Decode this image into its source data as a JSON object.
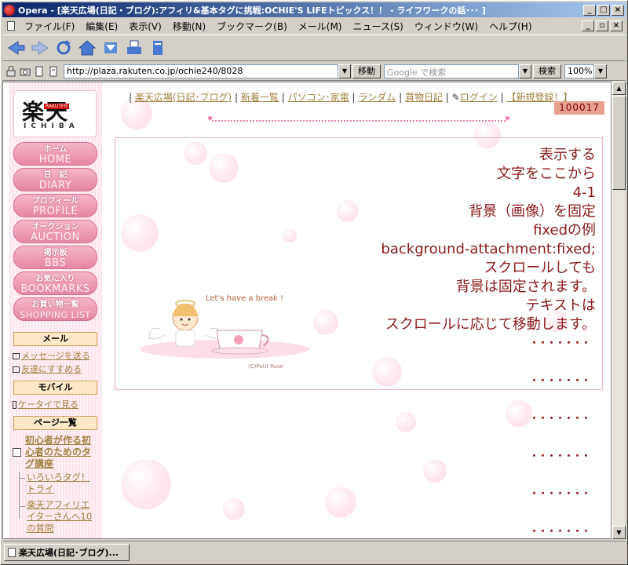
{
  "browser": {
    "title": "Opera - [楽天広場(日記・ブログ):アフィリ&基本タグに挑戦:OCHIE'S LIFEトピックス！！ - ライフワークの話･･･ ]",
    "menu": [
      "ファイル(F)",
      "編集(E)",
      "表示(V)",
      "移動(N)",
      "ブックマーク(B)",
      "メール(M)",
      "ニュース(S)",
      "ウィンドウ(W)",
      "ヘルプ(H)"
    ],
    "address": "http://plaza.rakuten.co.jp/ochie240/8028",
    "go_label": "移動",
    "search_placeholder": "Google で検索",
    "search_label": "検索",
    "zoom": "100%",
    "status_tab": "楽天広場(日記･ブログ)..."
  },
  "sidebar": {
    "logo_main": "楽天",
    "logo_tag": "RAKUTEN",
    "logo_sub": "ICHIBA",
    "nav": [
      {
        "jp": "ホーム",
        "en": "HOME"
      },
      {
        "jp": "日　記",
        "en": "DIARY"
      },
      {
        "jp": "プロフィール",
        "en": "PROFILE"
      },
      {
        "jp": "オークション",
        "en": "AUCTION"
      },
      {
        "jp": "掲示板",
        "en": "BBS"
      },
      {
        "jp": "お気に入り",
        "en": "BOOKMARKS"
      },
      {
        "jp": "お買い物一覧",
        "en": "SHOPPING LIST"
      }
    ],
    "mail_head": "メール",
    "mail_links": [
      "メッセージを送る",
      "友達にすすめる"
    ],
    "mobile_head": "モバイル",
    "mobile_link": "ケータイで見る",
    "pages_head": "ページ一覧",
    "pages_main": "初心者が作る初心者のためのタグ講座",
    "pages_sub1": "いろいろタグ！トライ",
    "pages_sub2": "楽天アフィリエイターさんへ10の質問"
  },
  "topnav": {
    "links": [
      "楽天広場(日記･ブログ)",
      "新着一覧",
      "パソコン･家電",
      "ランダム",
      "買物日記",
      "ログイン",
      "【新規登録！】"
    ],
    "counter": "100017"
  },
  "content": {
    "lines": [
      "表示する",
      "文字をここから",
      "4-1",
      "背景（画像）を固定",
      "fixedの例",
      "background-attachment:fixed;",
      "スクロールしても",
      "背景は固定されます。",
      "テキストは",
      "スクロールに応じて移動します。"
    ],
    "dots": "･･･････",
    "art_caption": "Let's have a break !",
    "art_credit": "(C)Petit Rose"
  },
  "colors": {
    "text": "#8b1a1a",
    "link": "#a08040",
    "pink": "#e586a2"
  }
}
